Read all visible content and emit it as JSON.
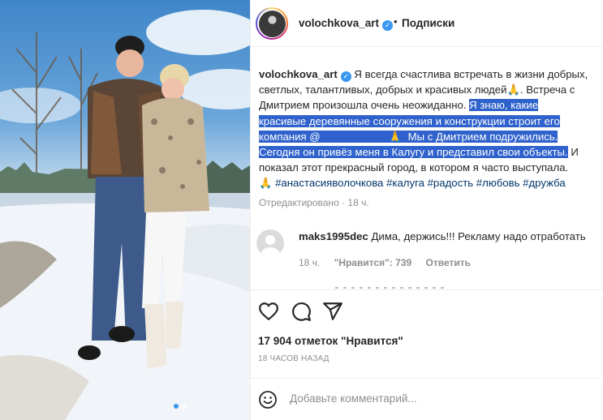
{
  "post": {
    "username": "volochkova_art",
    "follow_label": "Подписки",
    "dot": "•",
    "verified_mark": "✓"
  },
  "caption": {
    "username": "volochkova_art",
    "text_1": " Я всегда счастлива встречать в жизни добрых,\nсветлых, талантливых, добрых и красивых людей",
    "emoji_1": "🙏",
    "text_2": ". Встреча с\nДмитрием произошла очень неожиданно. ",
    "highlight_1": "Я знаю, какие\nкрасивые деревянные сооружения и конструкции строит его\nкомпания @",
    "redacted_mention": "                      ",
    "emoji_2": " 🙏 ",
    "highlight_2": " Мы с Дмитрием подружились.\nСегодня он привёз меня в Калугу и представил свои объекты.",
    "text_3": " И\nпоказал этот прекрасный город, в котором я часто выступала.\n",
    "emoji_3": "🙏",
    "hashtags": " #анастасияволочкова #калуга #радость #любовь #дружба",
    "edited": "Отредактировано · 18 ч."
  },
  "comment": {
    "username": "maks1995dec",
    "text": " Дима, держись!!! Рекламу надо отработать",
    "time": "18 ч.",
    "likes": "\"Нравится\": 739",
    "reply": "Ответить"
  },
  "actions": {
    "like_icon": "heart-icon",
    "comment_icon": "comment-bubble-icon",
    "share_icon": "paper-plane-icon"
  },
  "likes_count": "17 904 отметок \"Нравится\"",
  "time_ago": "18 ЧАСОВ НАЗАД",
  "add_comment": {
    "placeholder": "Добавьте комментарий...",
    "emoji_icon": "smiley-icon"
  },
  "colors": {
    "link": "#00376b",
    "highlight": "#2f62cc",
    "verified": "#3897f0",
    "muted": "#8e8e8e"
  }
}
